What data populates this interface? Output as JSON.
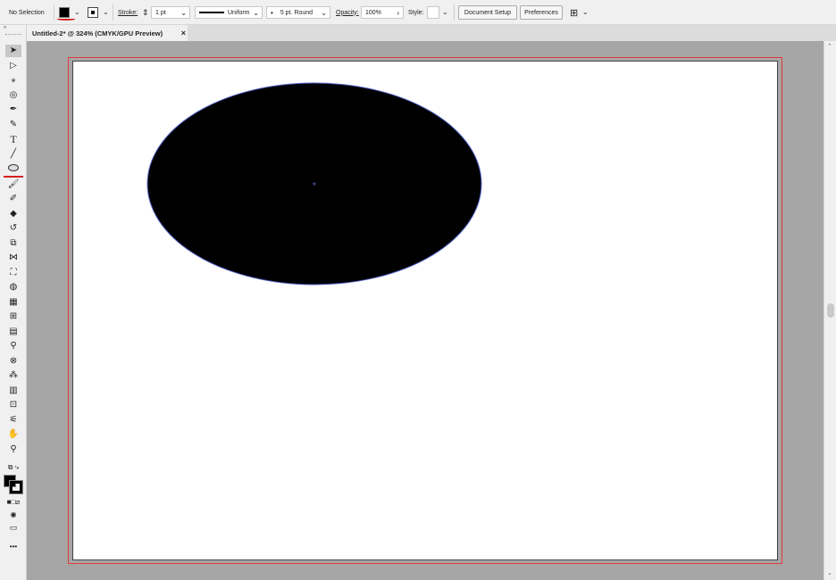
{
  "control_bar": {
    "selection_label": "No Selection",
    "stroke_label": "Stroke:",
    "stroke_value": "1 pt",
    "profile_label": "Uniform",
    "brush_label": "5 pt. Round",
    "opacity_label": "Opacity:",
    "opacity_value": "100%",
    "style_label": "Style:",
    "document_setup": "Document Setup",
    "preferences": "Preferences"
  },
  "document_tab": {
    "title": "Untitled-2* @ 324% (CMYK/GPU Preview)",
    "close": "×"
  },
  "canvas": {
    "ellipse_fill": "#000000",
    "ellipse_stroke": "#5566cc",
    "bleed_color": "#e03a3a"
  },
  "toolbar": {
    "type_tool_glyph": "T",
    "more_glyph": "•••"
  }
}
